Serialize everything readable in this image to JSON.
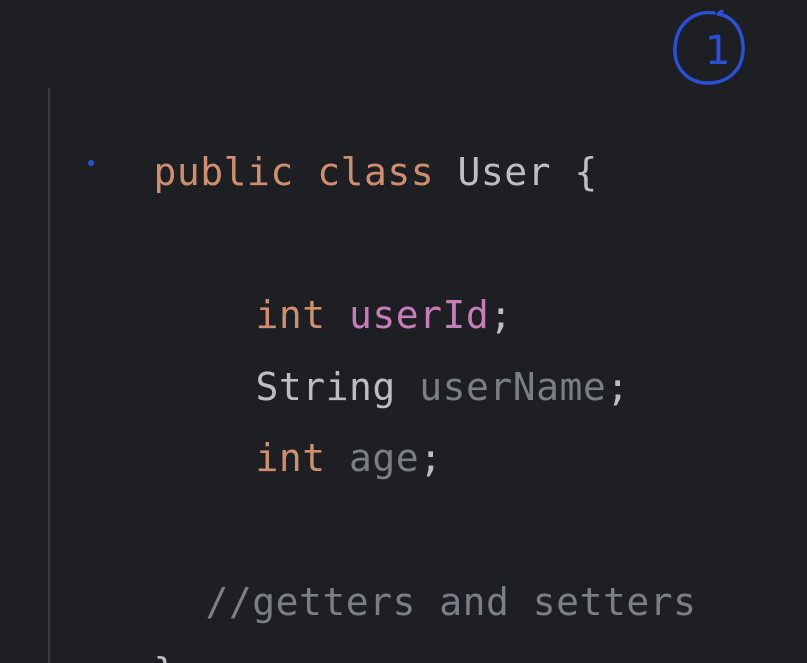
{
  "editor": {
    "lines": {
      "l1": {
        "kw1": "public",
        "kw2": "class",
        "name": "User",
        "brace": "{"
      },
      "l2": {
        "type": "int",
        "field": "userId",
        "semi": ";"
      },
      "l3": {
        "type": "String",
        "field": "userName",
        "semi": ";"
      },
      "l4": {
        "type": "int",
        "field": "age",
        "semi": ";"
      },
      "l5": {
        "comment": "//getters and setters"
      },
      "l6": {
        "brace": "}"
      }
    }
  },
  "annotation": {
    "number": "1",
    "color": "#2b4fd8"
  },
  "colors": {
    "background": "#1e1f22",
    "keyword": "#cf8e6d",
    "text": "#bcbec4",
    "field_used": "#c77dbb",
    "field_unused": "#7a7e85",
    "comment": "#7a7e85"
  }
}
